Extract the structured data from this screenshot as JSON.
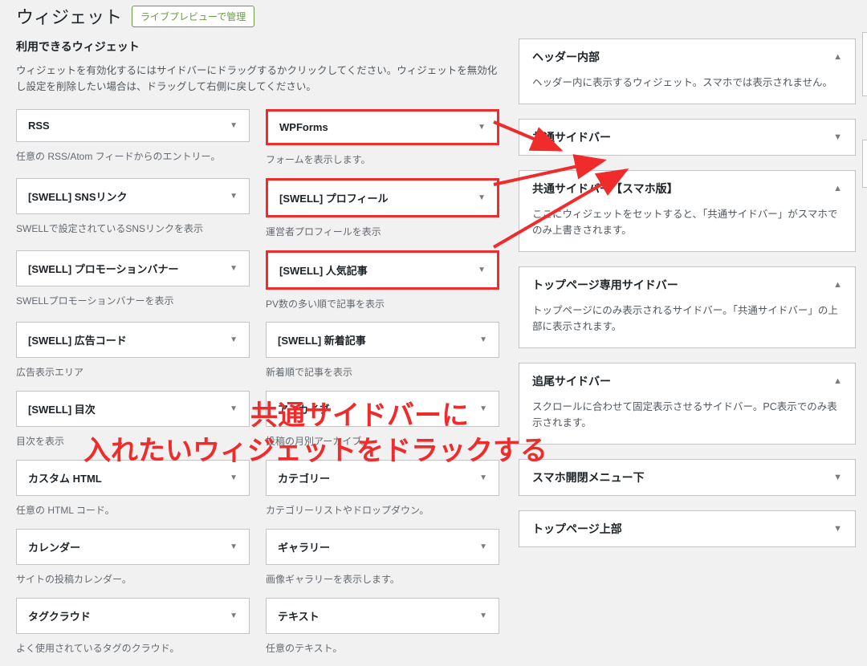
{
  "header": {
    "title": "ウィジェット",
    "preview_button": "ライブプレビューで管理"
  },
  "available": {
    "title": "利用できるウィジェット",
    "desc": "ウィジェットを有効化するにはサイドバーにドラッグするかクリックしてください。ウィジェットを無効化し設定を削除したい場合は、ドラッグして右側に戻してください。"
  },
  "widgets": [
    {
      "label": "RSS",
      "help": "任意の RSS/Atom フィードからのエントリー。",
      "highlight": false
    },
    {
      "label": "WPForms",
      "help": "フォームを表示します。",
      "highlight": true
    },
    {
      "label": "[SWELL] SNSリンク",
      "help": "SWELLで設定されているSNSリンクを表示",
      "highlight": false
    },
    {
      "label": "[SWELL] プロフィール",
      "help": "運営者プロフィールを表示",
      "highlight": true
    },
    {
      "label": "[SWELL] プロモーションバナー",
      "help": "SWELLプロモーションバナーを表示",
      "highlight": false
    },
    {
      "label": "[SWELL] 人気記事",
      "help": "PV数の多い順で記事を表示",
      "highlight": true
    },
    {
      "label": "[SWELL] 広告コード",
      "help": "広告表示エリア",
      "highlight": false
    },
    {
      "label": "[SWELL] 新着記事",
      "help": "新着順で記事を表示",
      "highlight": false
    },
    {
      "label": "[SWELL] 目次",
      "help": "目次を表示",
      "highlight": false
    },
    {
      "label": "アーカイブ",
      "help": "投稿の月別アーカイブ。",
      "highlight": false
    },
    {
      "label": "カスタム HTML",
      "help": "任意の HTML コード。",
      "highlight": false
    },
    {
      "label": "カテゴリー",
      "help": "カテゴリーリストやドロップダウン。",
      "highlight": false
    },
    {
      "label": "カレンダー",
      "help": "サイトの投稿カレンダー。",
      "highlight": false
    },
    {
      "label": "ギャラリー",
      "help": "画像ギャラリーを表示します。",
      "highlight": false
    },
    {
      "label": "タグクラウド",
      "help": "よく使用されているタグのクラウド。",
      "highlight": false
    },
    {
      "label": "テキスト",
      "help": "任意のテキスト。",
      "highlight": false
    }
  ],
  "areas": [
    {
      "label": "ヘッダー内部",
      "desc": "ヘッダー内に表示するウィジェット。スマホでは表示されません。",
      "open": true
    },
    {
      "label": "共通サイドバー",
      "desc": "",
      "open": false
    },
    {
      "label": "共通サイドバー【スマホ版】",
      "desc": "ここにウィジェットをセットすると、「共通サイドバー」がスマホでのみ上書きされます。",
      "open": true
    },
    {
      "label": "トップページ専用サイドバー",
      "desc": "トップページにのみ表示されるサイドバー。「共通サイドバー」の上部に表示されます。",
      "open": true
    },
    {
      "label": "追尾サイドバー",
      "desc": "スクロールに合わせて固定表示させるサイドバー。PC表示でのみ表示されます。",
      "open": true
    },
    {
      "label": "スマホ開閉メニュー下",
      "desc": "",
      "open": false
    },
    {
      "label": "トップページ上部",
      "desc": "",
      "open": false
    }
  ],
  "annotation": {
    "line1": "共通サイドバーに",
    "line2": "入れたいウィジェットをドラックする"
  }
}
